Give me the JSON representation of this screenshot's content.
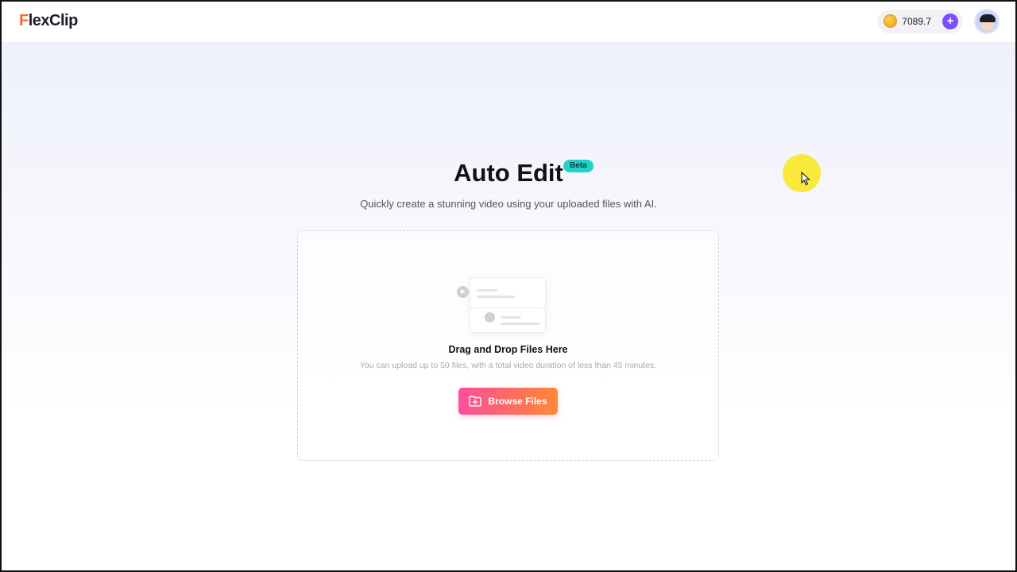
{
  "header": {
    "logo": {
      "initial": "F",
      "rest": "lexClip"
    },
    "credits": {
      "value": "7089.7",
      "icon": "coin-icon"
    },
    "add_credits_label": "+",
    "avatar_icon": "user-avatar"
  },
  "main": {
    "title": "Auto Edit",
    "badge": "Beta",
    "subtitle": "Quickly create a stunning video using your uploaded files with AI.",
    "dropzone": {
      "title": "Drag and Drop Files Here",
      "hint": "You can upload up to 50 files, with a total video duration of less than 45 minutes.",
      "button_label": "Browse Files",
      "button_icon": "folder-add-icon"
    }
  },
  "colors": {
    "brand_orange": "#f06a2d",
    "accent_purple": "#7c4dff",
    "beta_teal": "#1ed3c7",
    "button_gradient_start": "#fb4fa0",
    "button_gradient_end": "#fe8a37"
  }
}
